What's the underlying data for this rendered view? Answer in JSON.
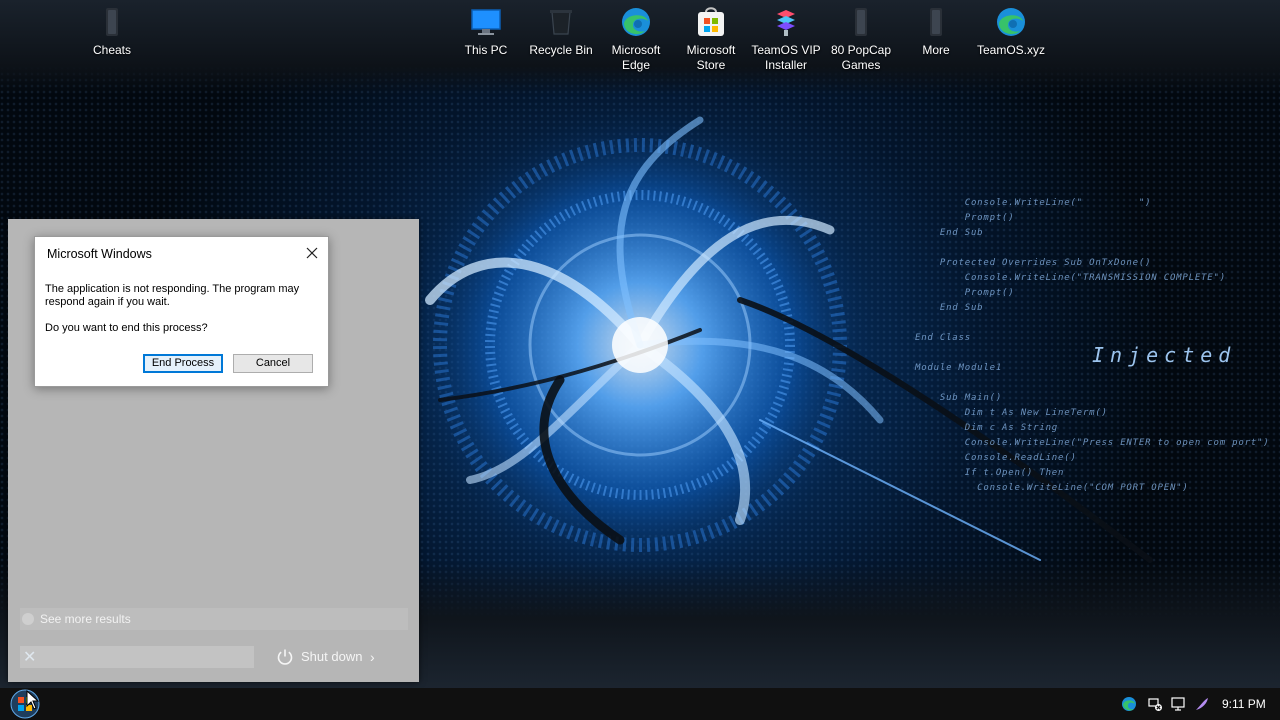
{
  "desktop": {
    "icons": [
      {
        "id": "cheats",
        "label": "Cheats"
      },
      {
        "id": "this-pc",
        "label": "This PC"
      },
      {
        "id": "recycle-bin",
        "label": "Recycle Bin"
      },
      {
        "id": "edge",
        "label": "Microsoft Edge"
      },
      {
        "id": "store",
        "label": "Microsoft Store"
      },
      {
        "id": "teamos-installer",
        "label": "TeamOS VIP Installer"
      },
      {
        "id": "popcap",
        "label": "80 PopCap Games"
      },
      {
        "id": "more",
        "label": "More"
      },
      {
        "id": "teamos-xyz",
        "label": "TeamOS.xyz"
      }
    ]
  },
  "wallpaper": {
    "code_lines": [
      "        Console.WriteLine(\"         \")",
      "        Prompt()",
      "    End Sub",
      "",
      "    Protected Overrides Sub OnTxDone()",
      "        Console.WriteLine(\"TRANSMISSION COMPLETE\")",
      "        Prompt()",
      "    End Sub",
      "",
      "End Class",
      "",
      "Module Module1",
      "",
      "    Sub Main()",
      "        Dim t As New LineTerm()",
      "        Dim c As String",
      "        Console.WriteLine(\"Press ENTER to open com port\")",
      "        Console.ReadLine()",
      "        If t.Open() Then",
      "          Console.WriteLine(\"COM PORT OPEN\")"
    ],
    "overlay_text": "Injected"
  },
  "dialog": {
    "title": "Microsoft Windows",
    "message": "The application is not responding. The program may respond again if you wait.",
    "question": "Do you want to end this process?",
    "primary_button": "End Process",
    "secondary_button": "Cancel"
  },
  "start_panel": {
    "see_more_results": "See more results",
    "shutdown_label": "Shut down"
  },
  "taskbar": {
    "clock": "9:11 PM"
  },
  "colors": {
    "accent": "#0078d7",
    "panel": "#b6b6b6",
    "taskbar": "#101010"
  }
}
